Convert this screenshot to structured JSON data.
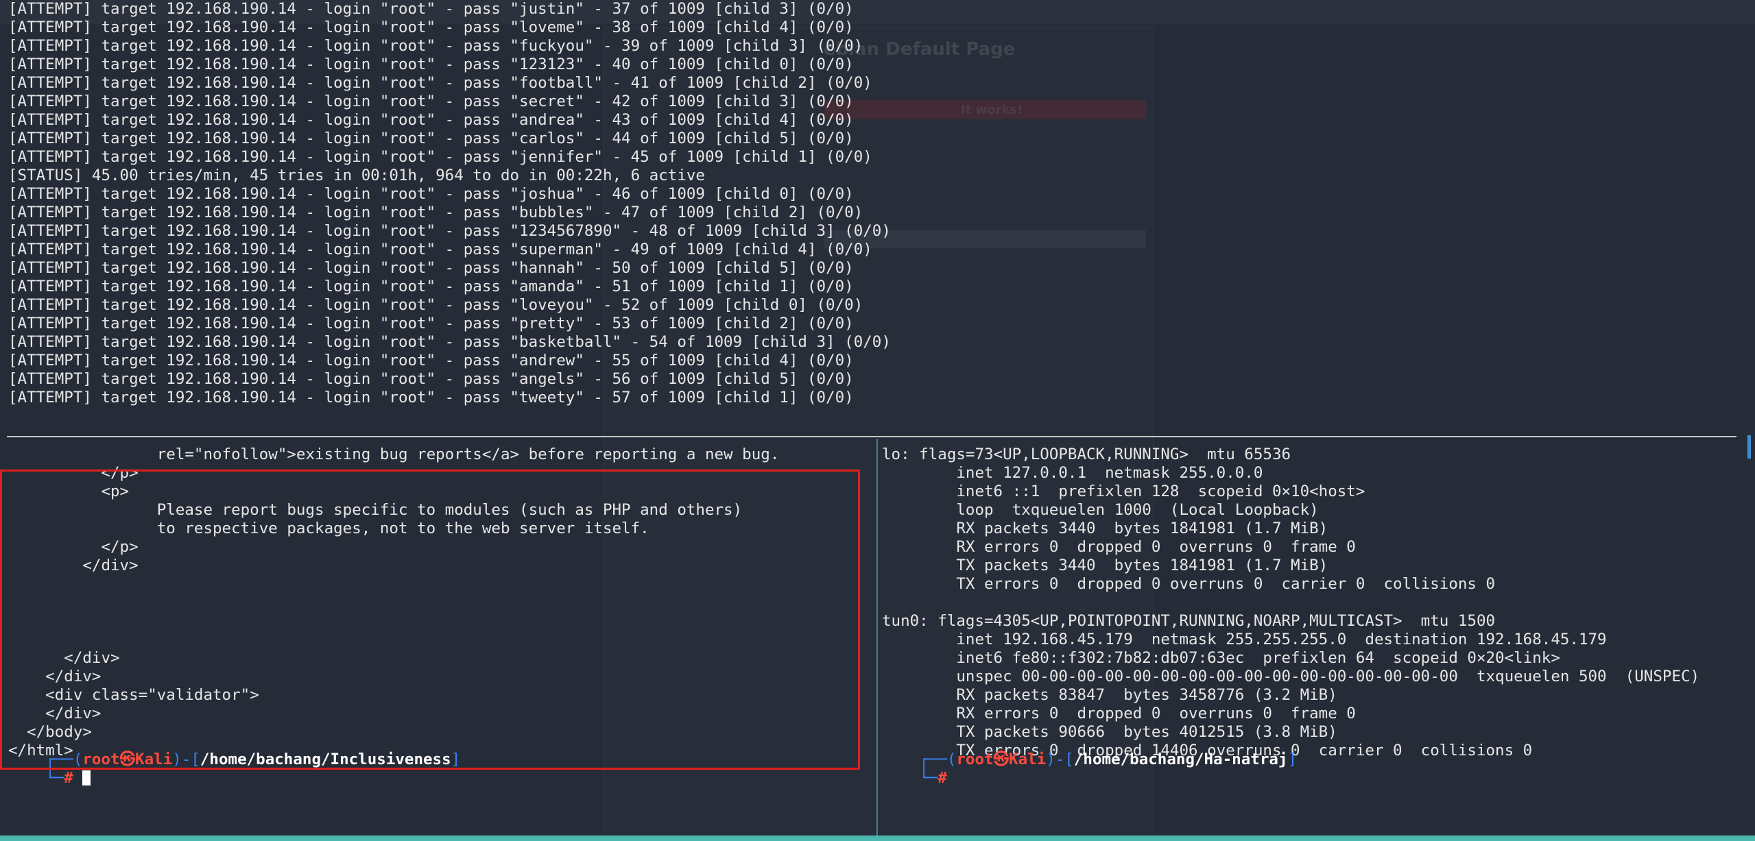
{
  "top_pane": {
    "lines": [
      "[ATTEMPT] target 192.168.190.14 - login \"root\" - pass \"justin\" - 37 of 1009 [child 3] (0/0)",
      "[ATTEMPT] target 192.168.190.14 - login \"root\" - pass \"loveme\" - 38 of 1009 [child 4] (0/0)",
      "[ATTEMPT] target 192.168.190.14 - login \"root\" - pass \"fuckyou\" - 39 of 1009 [child 3] (0/0)",
      "[ATTEMPT] target 192.168.190.14 - login \"root\" - pass \"123123\" - 40 of 1009 [child 0] (0/0)",
      "[ATTEMPT] target 192.168.190.14 - login \"root\" - pass \"football\" - 41 of 1009 [child 2] (0/0)",
      "[ATTEMPT] target 192.168.190.14 - login \"root\" - pass \"secret\" - 42 of 1009 [child 3] (0/0)",
      "[ATTEMPT] target 192.168.190.14 - login \"root\" - pass \"andrea\" - 43 of 1009 [child 4] (0/0)",
      "[ATTEMPT] target 192.168.190.14 - login \"root\" - pass \"carlos\" - 44 of 1009 [child 5] (0/0)",
      "[ATTEMPT] target 192.168.190.14 - login \"root\" - pass \"jennifer\" - 45 of 1009 [child 1] (0/0)",
      "[STATUS] 45.00 tries/min, 45 tries in 00:01h, 964 to do in 00:22h, 6 active",
      "[ATTEMPT] target 192.168.190.14 - login \"root\" - pass \"joshua\" - 46 of 1009 [child 0] (0/0)",
      "[ATTEMPT] target 192.168.190.14 - login \"root\" - pass \"bubbles\" - 47 of 1009 [child 2] (0/0)",
      "[ATTEMPT] target 192.168.190.14 - login \"root\" - pass \"1234567890\" - 48 of 1009 [child 3] (0/0)",
      "[ATTEMPT] target 192.168.190.14 - login \"root\" - pass \"superman\" - 49 of 1009 [child 4] (0/0)",
      "[ATTEMPT] target 192.168.190.14 - login \"root\" - pass \"hannah\" - 50 of 1009 [child 5] (0/0)",
      "[ATTEMPT] target 192.168.190.14 - login \"root\" - pass \"amanda\" - 51 of 1009 [child 1] (0/0)",
      "[ATTEMPT] target 192.168.190.14 - login \"root\" - pass \"loveyou\" - 52 of 1009 [child 0] (0/0)",
      "[ATTEMPT] target 192.168.190.14 - login \"root\" - pass \"pretty\" - 53 of 1009 [child 2] (0/0)",
      "[ATTEMPT] target 192.168.190.14 - login \"root\" - pass \"basketball\" - 54 of 1009 [child 3] (0/0)",
      "[ATTEMPT] target 192.168.190.14 - login \"root\" - pass \"andrew\" - 55 of 1009 [child 4] (0/0)",
      "[ATTEMPT] target 192.168.190.14 - login \"root\" - pass \"angels\" - 56 of 1009 [child 5] (0/0)",
      "[ATTEMPT] target 192.168.190.14 - login \"root\" - pass \"tweety\" - 57 of 1009 [child 1] (0/0)"
    ]
  },
  "background_page": {
    "title": "ebian Default Page",
    "banner": "It works!"
  },
  "left_pane": {
    "lines": [
      "                rel=\"nofollow\">existing bug reports</a> before reporting a new bug.",
      "          </p>",
      "          <p>",
      "                Please report bugs specific to modules (such as PHP and others)",
      "                to respective packages, not to the web server itself.",
      "          </p>",
      "        </div>",
      "",
      "",
      "",
      "",
      "      </div>",
      "    </div>",
      "    <div class=\"validator\">",
      "    </div>",
      "  </body>",
      "</html>"
    ],
    "prompt": {
      "open": "┌──(",
      "user": "root㉿Kali",
      "mid": ")-[",
      "path": "/home/bachang/Inclusiveness",
      "close": "]",
      "second": "└─",
      "hash": "#"
    }
  },
  "right_pane": {
    "lines": [
      "lo: flags=73<UP,LOOPBACK,RUNNING>  mtu 65536",
      "        inet 127.0.0.1  netmask 255.0.0.0",
      "        inet6 ::1  prefixlen 128  scopeid 0×10<host>",
      "        loop  txqueuelen 1000  (Local Loopback)",
      "        RX packets 3440  bytes 1841981 (1.7 MiB)",
      "        RX errors 0  dropped 0  overruns 0  frame 0",
      "        TX packets 3440  bytes 1841981 (1.7 MiB)",
      "        TX errors 0  dropped 0 overruns 0  carrier 0  collisions 0",
      "",
      "tun0: flags=4305<UP,POINTOPOINT,RUNNING,NOARP,MULTICAST>  mtu 1500",
      "        inet 192.168.45.179  netmask 255.255.255.0  destination 192.168.45.179",
      "        inet6 fe80::f302:7b82:db07:63ec  prefixlen 64  scopeid 0×20<link>",
      "        unspec 00-00-00-00-00-00-00-00-00-00-00-00-00-00-00-00  txqueuelen 500  (UNSPEC)",
      "        RX packets 83847  bytes 3458776 (3.2 MiB)",
      "        RX errors 0  dropped 0  overruns 0  frame 0",
      "        TX packets 90666  bytes 4012515 (3.8 MiB)",
      "        TX errors 0  dropped 14406 overruns 0  carrier 0  collisions 0"
    ],
    "prompt": {
      "open": "┌──(",
      "user": "root㉿Kali",
      "mid": ")-[",
      "path": "/home/bachang/Ha-natraj",
      "close": "]",
      "second": "└─",
      "hash": "#"
    }
  },
  "colors": {
    "background": "#262c37",
    "prompt_bracket": "#3b82f6",
    "prompt_user": "#ff4a3d",
    "highlight_box": "#e0201c",
    "pane_divider": "#2e8c86",
    "status_bar": "#4db8b0"
  }
}
